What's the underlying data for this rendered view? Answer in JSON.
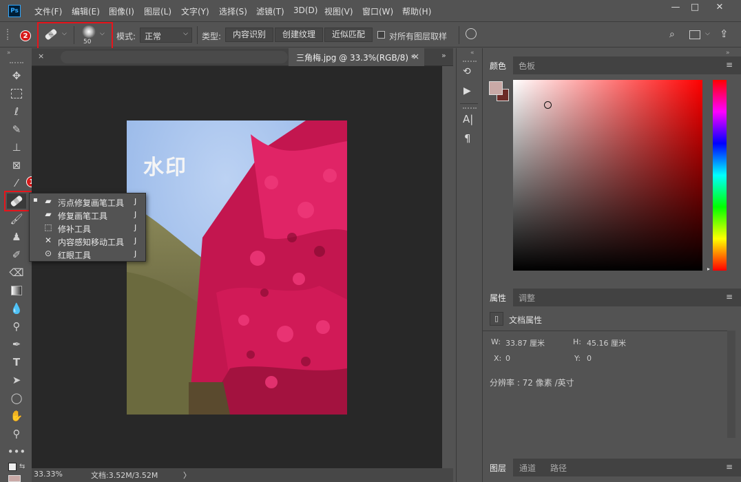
{
  "app": {
    "logo": "Ps"
  },
  "menu": [
    "文件(F)",
    "编辑(E)",
    "图像(I)",
    "图层(L)",
    "文字(Y)",
    "选择(S)",
    "滤镜(T)",
    "3D(D)",
    "视图(V)",
    "窗口(W)",
    "帮助(H)"
  ],
  "window_controls": {
    "minimize": "—",
    "maximize": "□",
    "close": "✕"
  },
  "options": {
    "brush_size": "50",
    "mode_label": "模式:",
    "mode_value": "正常",
    "type_label": "类型:",
    "type_buttons": [
      "内容识别",
      "创建纹理",
      "近似匹配"
    ],
    "sample_all_label": "对所有图层取样"
  },
  "annotations": {
    "badge1": "1",
    "badge2": "2"
  },
  "document": {
    "tab_title": "三角梅.jpg @ 33.3%(RGB/8) *",
    "close": "×",
    "watermark": "水印"
  },
  "flyout": {
    "items": [
      {
        "label": "污点修复画笔工具",
        "key": "J",
        "icon": "spot-healing-brush-icon",
        "active": true
      },
      {
        "label": "修复画笔工具",
        "key": "J",
        "icon": "healing-brush-icon",
        "active": false
      },
      {
        "label": "修补工具",
        "key": "J",
        "icon": "patch-icon",
        "active": false
      },
      {
        "label": "内容感知移动工具",
        "key": "J",
        "icon": "content-aware-move-icon",
        "active": false
      },
      {
        "label": "红眼工具",
        "key": "J",
        "icon": "red-eye-icon",
        "active": false
      }
    ]
  },
  "status": {
    "zoom": "33.33%",
    "doc_size": "文档:3.52M/3.52M",
    "arrow": "〉"
  },
  "right_panel": {
    "color_tabs": [
      "颜色",
      "色板"
    ],
    "props_tabs": [
      "属性",
      "调整"
    ],
    "props_title": "文档属性",
    "w_label": "W:",
    "w_value": "33.87 厘米",
    "h_label": "H:",
    "h_value": "45.16 厘米",
    "x_label": "X:",
    "x_value": "0",
    "y_label": "Y:",
    "y_value": "0",
    "resolution": "分辨率 : 72 像素 /英寸",
    "layers_tabs": [
      "图层",
      "通道",
      "路径"
    ]
  },
  "colors": {
    "accent_red": "#e8141b",
    "foreground": "#c9a9a6",
    "background": "#6b2a26",
    "hue_top": "#ff0000"
  }
}
